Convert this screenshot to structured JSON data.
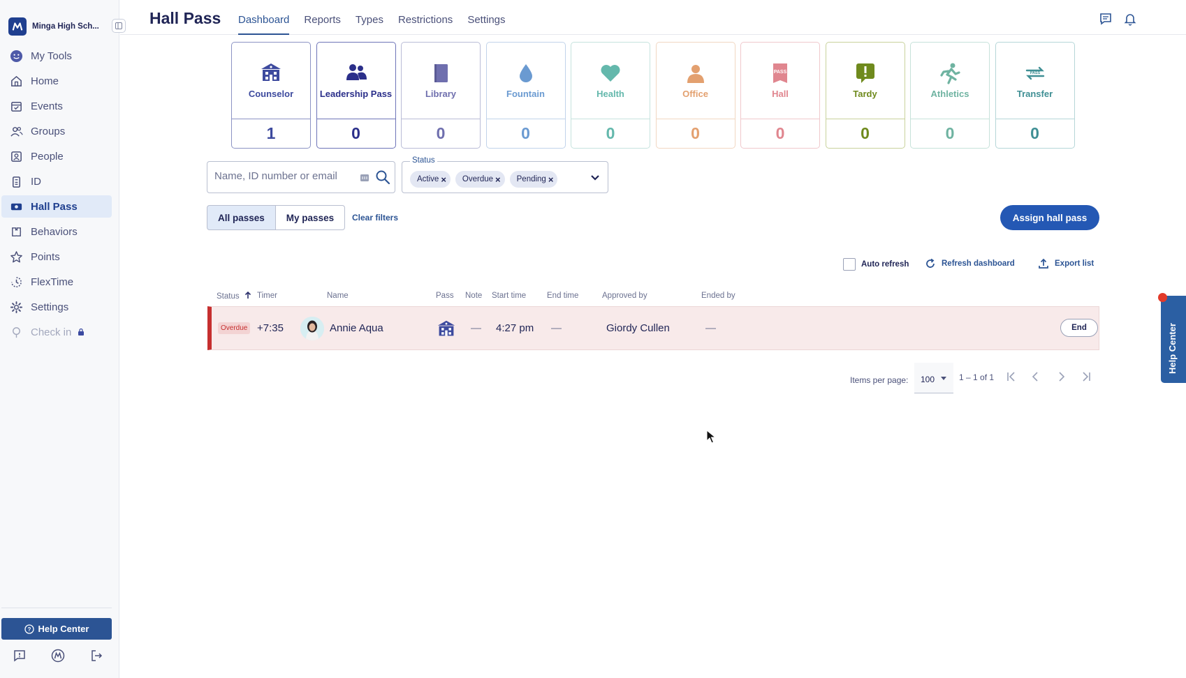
{
  "sidebar": {
    "school": "Minga High Sch...",
    "items": [
      {
        "label": "My Tools",
        "icon": "smiley-icon"
      },
      {
        "label": "Home",
        "icon": "home-icon"
      },
      {
        "label": "Events",
        "icon": "calendar-check-icon"
      },
      {
        "label": "Groups",
        "icon": "groups-icon"
      },
      {
        "label": "People",
        "icon": "person-badge-icon"
      },
      {
        "label": "ID",
        "icon": "id-badge-icon"
      },
      {
        "label": "Hall Pass",
        "icon": "hall-pass-icon",
        "active": true
      },
      {
        "label": "Behaviors",
        "icon": "behaviors-icon"
      },
      {
        "label": "Points",
        "icon": "star-icon"
      },
      {
        "label": "FlexTime",
        "icon": "flextime-icon"
      },
      {
        "label": "Settings",
        "icon": "gear-icon"
      },
      {
        "label": "Check in",
        "icon": "checkin-icon",
        "disabled": true
      }
    ],
    "help_center": "Help Center"
  },
  "header": {
    "title": "Hall Pass",
    "tabs": [
      "Dashboard",
      "Reports",
      "Types",
      "Restrictions",
      "Settings"
    ],
    "active_tab": "Dashboard"
  },
  "pass_types": [
    {
      "label": "Counselor",
      "count": "1",
      "color": "#3d4a9e",
      "border": "#8b93c4"
    },
    {
      "label": "Leadership Pass",
      "count": "0",
      "color": "#2b2f8a",
      "border": "#6e74b8"
    },
    {
      "label": "Library",
      "count": "0",
      "color": "#6f6fae",
      "border": "#b9bcd6"
    },
    {
      "label": "Fountain",
      "count": "0",
      "color": "#6a9ad1",
      "border": "#c1d3ea"
    },
    {
      "label": "Health",
      "count": "0",
      "color": "#64b8ac",
      "border": "#c6e3de"
    },
    {
      "label": "Office",
      "count": "0",
      "color": "#e3a06f",
      "border": "#f1d7c2"
    },
    {
      "label": "Hall",
      "count": "0",
      "color": "#e0868f",
      "border": "#f0c8cc"
    },
    {
      "label": "Tardy",
      "count": "0",
      "color": "#6f8a1d",
      "border": "#c8d29c"
    },
    {
      "label": "Athletics",
      "count": "0",
      "color": "#6fb3a1",
      "border": "#c6e2da"
    },
    {
      "label": "Transfer",
      "count": "0",
      "color": "#3f8f94",
      "border": "#b5d6d8"
    }
  ],
  "filters": {
    "search_placeholder": "Name, ID number or email",
    "status_label": "Status",
    "status_chips": [
      "Active",
      "Overdue",
      "Pending"
    ],
    "all_passes": "All passes",
    "my_passes": "My passes",
    "clear_filters": "Clear filters",
    "assign": "Assign hall pass"
  },
  "actions": {
    "auto_refresh": "Auto refresh",
    "refresh_dashboard": "Refresh dashboard",
    "export_list": "Export list"
  },
  "table": {
    "columns": [
      "Status",
      "Timer",
      "Name",
      "Pass",
      "Note",
      "Start time",
      "End time",
      "Approved by",
      "Ended by"
    ],
    "rows": [
      {
        "status": "Overdue",
        "timer": "+7:35",
        "name": "Annie Aqua",
        "pass_icon": "counselor-icon",
        "note": "—",
        "start_time": "4:27 pm",
        "end_time": "—",
        "approved_by": "Giordy Cullen",
        "ended_by": "—",
        "action": "End"
      }
    ]
  },
  "pagination": {
    "items_per_page_label": "Items per page:",
    "items_per_page": "100",
    "range": "1 – 1 of 1"
  },
  "help_tab": "Help Center"
}
